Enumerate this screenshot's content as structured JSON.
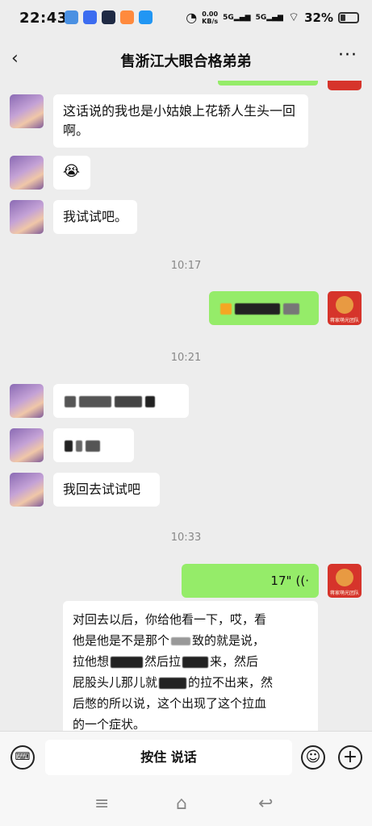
{
  "status": {
    "time": "22:43",
    "speed_top": "0.00",
    "speed_bottom": "KB/s",
    "net1": "5G",
    "net2": "5G",
    "battery": "32%",
    "battery_level": 0.32
  },
  "header": {
    "back_icon": "chevron-left-icon",
    "title": "售浙江大眼合格弟弟",
    "more": "···"
  },
  "messages": {
    "m1": "这话说的我也是小姑娘上花轿人生头一回啊。",
    "m2_emoji": "😭",
    "m3": "我试试吧。",
    "ts1": "10:17",
    "ts2": "10:21",
    "m6": "我回去试试吧",
    "ts3": "10:33",
    "voice": "17\"",
    "voice_icon": "voice-wave-icon",
    "transcript_lines": [
      "对回去以后，你给他看一下，哎，看",
      "他是他是不是那个",
      "致的就是说，",
      "拉他想",
      "然后拉",
      "来，然后",
      "屁股头儿那儿就",
      "的拉不出来，然",
      "后憋的所以说，这个出现了这个拉血",
      "的一个症状。"
    ],
    "avatar_caption": "蒋家萌光团队"
  },
  "input": {
    "hold_to_talk": "按住 说话",
    "keyboard_icon": "keyboard-icon",
    "emoji_icon": "smile-icon",
    "plus_icon": "plus-icon"
  },
  "nav": {
    "menu": "≡",
    "home": "⌂",
    "back": "↩"
  }
}
